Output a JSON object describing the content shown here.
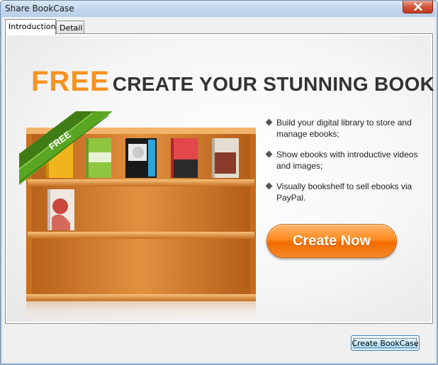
{
  "window": {
    "title": "Share BookCase"
  },
  "tabs": [
    {
      "label": "Introduction",
      "active": true
    },
    {
      "label": "Detail",
      "active": false
    }
  ],
  "banner": {
    "headline_free": "FREE",
    "headline_rest": "CREATE YOUR STUNNING BOOK CASE",
    "ribbon_text": "FREE",
    "bullets": [
      "Build your digital library to store and manage ebooks;",
      "Show ebooks with introductive videos and images;",
      "Visually bookshelf to sell ebooks via PayPal."
    ],
    "create_now_label": "Create Now"
  },
  "footer": {
    "create_bookcase_label": "Create BookCase"
  },
  "colors": {
    "accent_orange": "#f7921e",
    "ribbon_green": "#5aa623",
    "shelf_wood": "#d9822b"
  }
}
